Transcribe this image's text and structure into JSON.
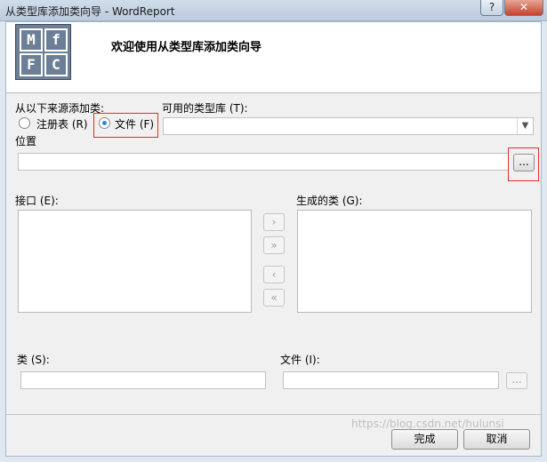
{
  "window": {
    "title": "从类型库添加类向导 - WordReport",
    "help_label": "?",
    "close_label": "✕"
  },
  "header": {
    "title": "欢迎使用从类型库添加类向导",
    "logo_letters": [
      "M",
      "f",
      "F",
      "C"
    ]
  },
  "source": {
    "group_label": "从以下来源添加类:",
    "options": [
      {
        "label": "注册表 (R)",
        "selected": false
      },
      {
        "label": "文件 (F)",
        "selected": true
      }
    ]
  },
  "typelib": {
    "label": "可用的类型库 (T):",
    "value": ""
  },
  "location": {
    "label": "位置",
    "value": "",
    "browse_label": "..."
  },
  "interfaces": {
    "label": "接口 (E):",
    "items": []
  },
  "move_buttons": {
    "add_one": "›",
    "add_all": "»",
    "remove_one": "‹",
    "remove_all": "«"
  },
  "generated": {
    "label": "生成的类 (G):",
    "items": []
  },
  "class_field": {
    "label": "类 (S):",
    "value": ""
  },
  "file_field": {
    "label": "文件 (I):",
    "value": "",
    "browse_label": "..."
  },
  "footer": {
    "finish_label": "完成",
    "cancel_label": "取消"
  },
  "watermark": "https://blog.csdn.net/hulunsi"
}
